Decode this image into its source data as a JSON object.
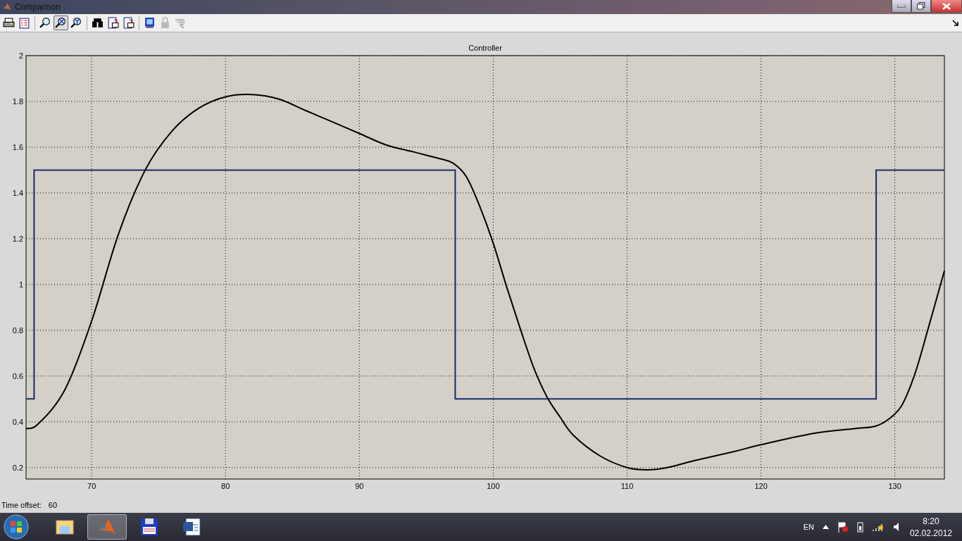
{
  "window": {
    "title": "Comparison"
  },
  "toolbar": [
    {
      "selected": false,
      "disabled": false
    },
    {
      "selected": false,
      "disabled": false
    },
    {
      "selected": false,
      "disabled": false
    },
    {
      "selected": true,
      "disabled": false
    },
    {
      "selected": false,
      "disabled": false
    },
    {
      "selected": false,
      "disabled": false
    },
    {
      "selected": false,
      "disabled": false
    },
    {
      "selected": false,
      "disabled": false
    },
    {
      "selected": false,
      "disabled": false
    },
    {
      "selected": false,
      "disabled": true
    },
    {
      "selected": false,
      "disabled": true
    }
  ],
  "chart_data": {
    "type": "line",
    "title": "Controller",
    "xlim": [
      65.1,
      133.7
    ],
    "ylim": [
      0.15,
      2
    ],
    "xticks": [
      70,
      80,
      90,
      100,
      110,
      120,
      130
    ],
    "yticks": [
      0.2,
      0.4,
      0.6,
      0.8,
      1,
      1.2,
      1.4,
      1.6,
      1.8,
      2
    ],
    "grid": true,
    "series": [
      {
        "color": "#1a2a6c",
        "x": [
          65.1,
          65.7,
          65.7,
          97.16,
          97.16,
          128.6,
          128.6,
          133.7
        ],
        "values": [
          0.5,
          0.5,
          1.5,
          1.5,
          0.5,
          0.5,
          1.5,
          1.5
        ]
      },
      {
        "color": "#000000",
        "x": [
          65.1,
          66,
          68,
          70,
          72,
          74,
          76,
          78,
          80,
          82,
          84,
          86,
          88,
          90,
          92,
          94,
          96,
          97,
          98,
          99,
          100,
          101,
          102,
          103,
          104,
          105,
          106,
          108,
          110,
          111.5,
          113,
          115,
          118,
          120,
          124,
          127,
          128.5,
          129.5,
          130.5,
          131.5,
          132.5,
          133.7
        ],
        "values": [
          0.37,
          0.39,
          0.54,
          0.84,
          1.22,
          1.5,
          1.67,
          1.77,
          1.82,
          1.83,
          1.81,
          1.76,
          1.71,
          1.66,
          1.61,
          1.58,
          1.55,
          1.53,
          1.47,
          1.34,
          1.18,
          0.99,
          0.81,
          0.64,
          0.51,
          0.42,
          0.34,
          0.25,
          0.2,
          0.19,
          0.2,
          0.23,
          0.27,
          0.3,
          0.35,
          0.37,
          0.38,
          0.41,
          0.47,
          0.61,
          0.81,
          1.06
        ]
      }
    ]
  },
  "status": {
    "label": "Time offset:",
    "value": "60"
  },
  "taskbar": {
    "apps": [
      {
        "selected": false
      },
      {
        "selected": true
      },
      {
        "selected": false
      },
      {
        "selected": false
      }
    ],
    "language": "EN",
    "time": "8:20",
    "date": "02.02.2012"
  }
}
